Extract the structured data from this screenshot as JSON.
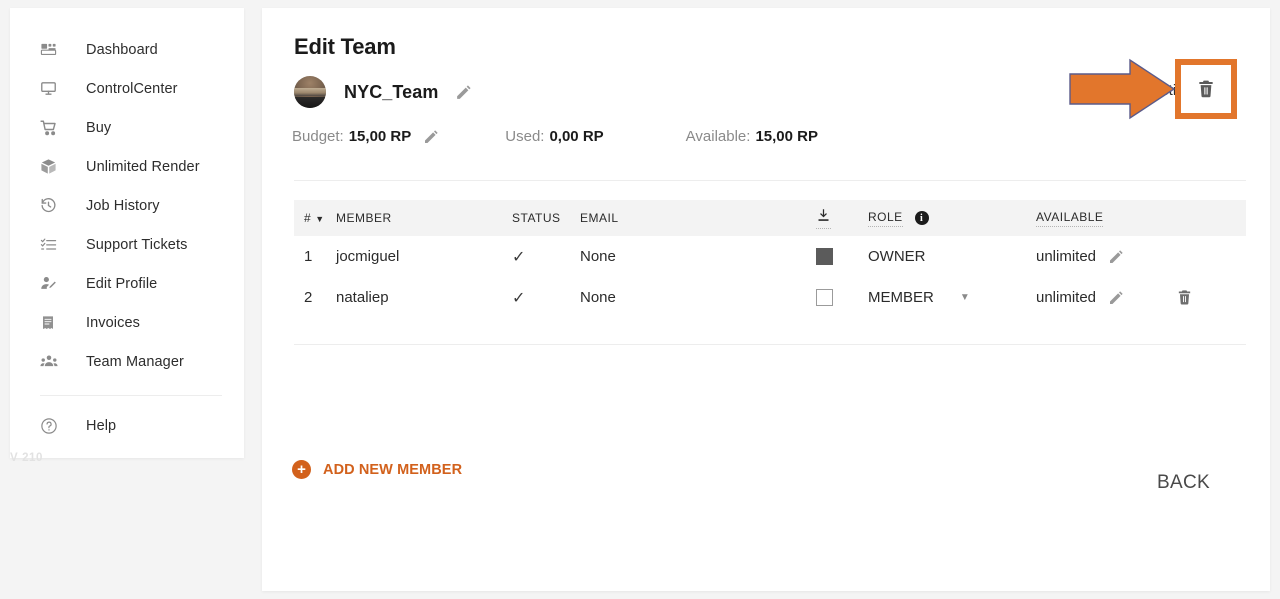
{
  "app": {
    "version_label": "V 210"
  },
  "sidebar": {
    "items": [
      {
        "icon": "dashboard-icon",
        "label": "Dashboard"
      },
      {
        "icon": "monitor-icon",
        "label": "ControlCenter"
      },
      {
        "icon": "shopping-cart-icon",
        "label": "Buy"
      },
      {
        "icon": "package-box-icon",
        "label": "Unlimited Render"
      },
      {
        "icon": "history-clock-icon",
        "label": "Job History"
      },
      {
        "icon": "checklist-icon",
        "label": "Support Tickets"
      },
      {
        "icon": "user-edit-icon",
        "label": "Edit Profile"
      },
      {
        "icon": "receipt-icon",
        "label": "Invoices"
      },
      {
        "icon": "people-group-icon",
        "label": "Team Manager"
      }
    ],
    "help": {
      "icon": "help-circle-icon",
      "label": "Help"
    }
  },
  "main": {
    "title": "Edit Team",
    "team": {
      "name": "NYC_Team",
      "avatar": "team-avatar-photo",
      "edit_icon": "pencil-icon"
    },
    "budget": {
      "budget_label": "Budget:",
      "budget_value": "15,00 RP",
      "budget_edit_icon": "pencil-icon",
      "used_label": "Used:",
      "used_value": "0,00 RP",
      "available_label": "Available:",
      "available_value": "15,00 RP"
    },
    "admin_toggle": {
      "label": "Active",
      "checked": true,
      "color": "#d2611c"
    },
    "delete_team": {
      "icon": "trash-icon",
      "highlighted": true,
      "highlight_color": "#e2762c"
    },
    "annotation": {
      "type": "arrow-right",
      "color": "#e2762c",
      "points_to": "delete-team-button"
    }
  },
  "table": {
    "columns": [
      {
        "key": "num",
        "label": "#",
        "sortable": true,
        "sort_caret": "▼"
      },
      {
        "key": "member",
        "label": "MEMBER",
        "sortable": false
      },
      {
        "key": "status",
        "label": "STATUS",
        "sortable": false
      },
      {
        "key": "email",
        "label": "EMAIL",
        "sortable": false
      },
      {
        "key": "dl",
        "label": "",
        "icon": "download-icon",
        "dotted": true
      },
      {
        "key": "role",
        "label": "ROLE",
        "dotted": true,
        "info_icon": "info-icon",
        "info_glyph": "i"
      },
      {
        "key": "avail",
        "label": "AVAILABLE",
        "dotted": true
      }
    ],
    "rows": [
      {
        "num": "1",
        "member": "jocmiguel",
        "status_icon": "check-icon",
        "status_glyph": "✓",
        "email": "None",
        "selected": true,
        "role": "OWNER",
        "role_has_dropdown": false,
        "available": "unlimited",
        "edit_icon": "pencil-icon",
        "delete_icon": null
      },
      {
        "num": "2",
        "member": "nataliep",
        "status_icon": "check-icon",
        "status_glyph": "✓",
        "email": "None",
        "selected": false,
        "role": "MEMBER",
        "role_has_dropdown": true,
        "role_caret": "▼",
        "available": "unlimited",
        "edit_icon": "pencil-icon",
        "delete_icon": "trash-icon"
      }
    ]
  },
  "footer": {
    "add_member_label": "ADD NEW MEMBER",
    "add_member_icon": "plus-circle-icon",
    "back_label": "BACK"
  }
}
